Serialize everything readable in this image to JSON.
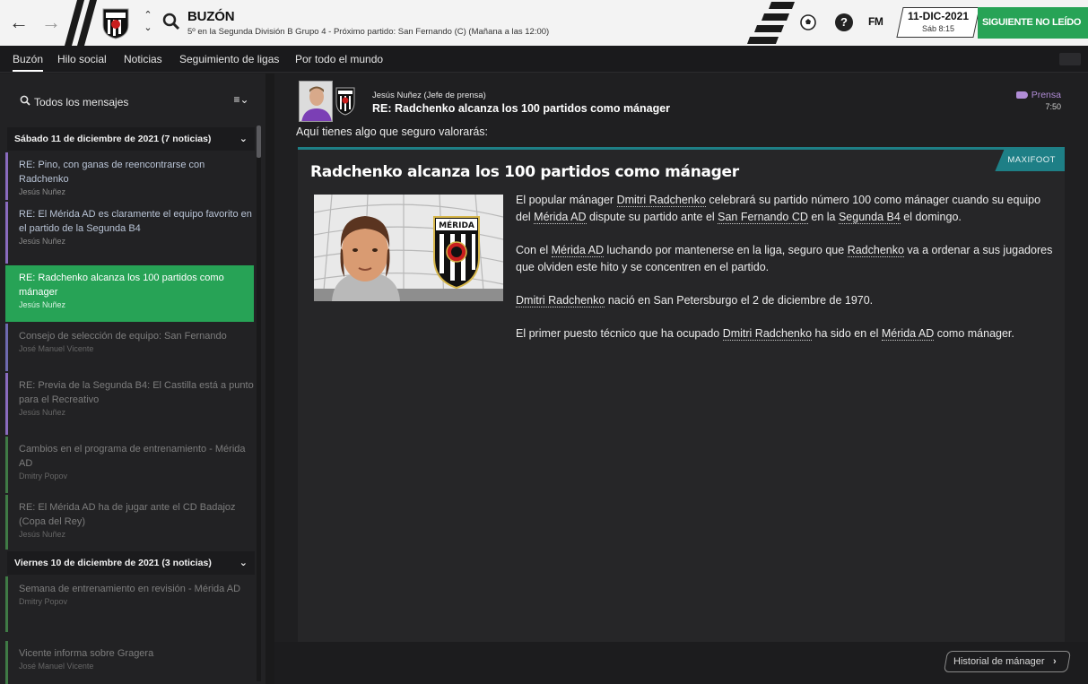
{
  "topbar": {
    "title": "BUZÓN",
    "subtitle": "5º en la Segunda División B Grupo 4 - Próximo partido: San Fernando (C) (Mañana a las 12:00)",
    "fm_logo": "FM",
    "date": "11-DIC-2021",
    "day_time": "Sáb 8:15",
    "next_unread": "SIGUIENTE NO LEÍDO"
  },
  "tabs": [
    {
      "label": "Buzón"
    },
    {
      "label": "Hilo social"
    },
    {
      "label": "Noticias"
    },
    {
      "label": "Seguimiento de ligas"
    },
    {
      "label": "Por todo el mundo"
    }
  ],
  "inbox": {
    "filter_label": "Todos los mensajes",
    "groups": [
      {
        "label": "Sábado 11 de diciembre de 2021 (7 noticias)"
      },
      {
        "label": "Viernes 10 de diciembre de 2021 (3 noticias)"
      }
    ],
    "messages": [
      {
        "title": "RE: Pino, con ganas de reencontrarse con Radchenko",
        "from": "Jesús Nuñez"
      },
      {
        "title": "RE: El Mérida AD es claramente el equipo favorito en el partido de la Segunda B4",
        "from": "Jesús Nuñez"
      },
      {
        "title": "RE: Radchenko alcanza los 100 partidos como mánager",
        "from": "Jesús Nuñez"
      },
      {
        "title": "Consejo de selección de equipo: San Fernando",
        "from": "José Manuel Vicente"
      },
      {
        "title": "RE: Previa de la Segunda B4: El Castilla está a punto para el Recreativo",
        "from": "Jesús Nuñez"
      },
      {
        "title": "Cambios en el programa de entrenamiento - Mérida AD",
        "from": "Dmitry Popov"
      },
      {
        "title": "RE: El Mérida AD ha de jugar ante el CD Badajoz (Copa del Rey)",
        "from": "Jesús Nuñez"
      },
      {
        "title": "Semana de entrenamiento en revisión - Mérida AD",
        "from": "Dmitry Popov"
      },
      {
        "title": "Vicente informa sobre Gragera",
        "from": "José Manuel Vicente"
      }
    ]
  },
  "message": {
    "sender": "Jesús Nuñez  (Jefe de prensa)",
    "subject": "RE: Radchenko alcanza los 100 partidos como mánager",
    "category": "Prensa",
    "time": "7:50",
    "intro": "Aquí tienes algo que seguro valorarás:",
    "source": "MAXIFOOT",
    "article_title": "Radchenko alcanza los 100 partidos como mánager",
    "crest_text": "MÉRIDA",
    "p1": {
      "a": "El popular mánager ",
      "l1": "Dmitri Radchenko",
      "b": " celebrará su partido número 100 como mánager cuando su equipo del ",
      "l2": "Mérida AD",
      "c": " dispute su partido ante el ",
      "l3": "San Fernando CD",
      "d": " en la ",
      "l4": "Segunda B4",
      "e": " el domingo."
    },
    "p2": {
      "a": "Con el ",
      "l1": "Mérida AD",
      "b": " luchando por mantenerse en la liga, seguro que ",
      "l2": "Radchenko",
      "c": " va a ordenar a sus jugadores que olviden este hito y se concentren en el partido."
    },
    "p3": {
      "l1": "Dmitri Radchenko",
      "a": " nació en San Petersburgo el 2 de diciembre de 1970."
    },
    "p4": {
      "a": "El primer puesto técnico que ha ocupado ",
      "l1": "Dmitri Radchenko",
      "b": " ha sido en el ",
      "l2": "Mérida AD",
      "c": " como mánager."
    },
    "history_button": "Historial de mánager"
  },
  "colors": {
    "accent_green": "#27a356",
    "press_purple": "#b08cd6",
    "source_teal": "#1e7f86"
  }
}
